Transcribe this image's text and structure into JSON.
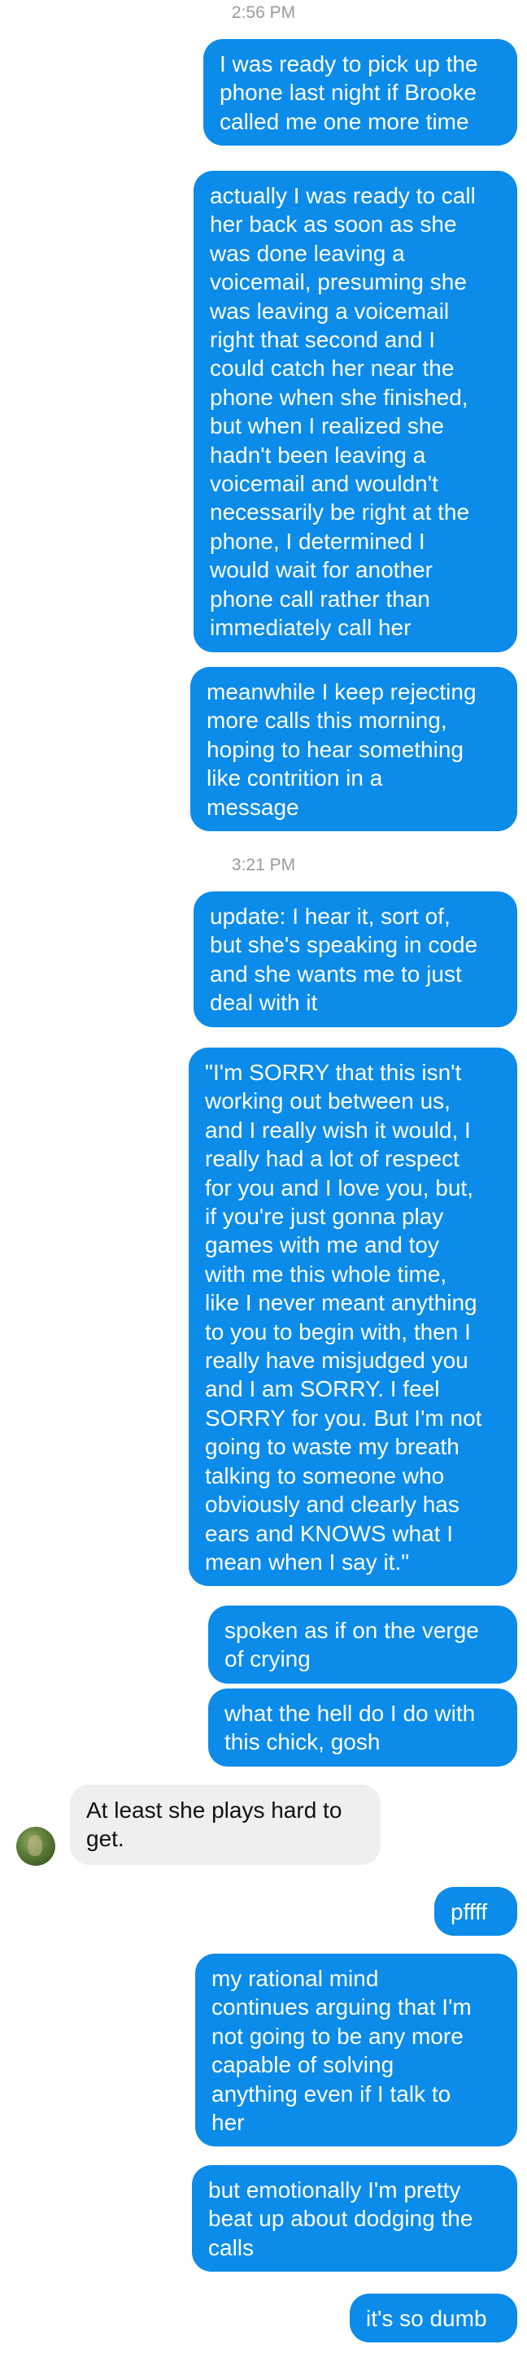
{
  "colors": {
    "outgoing_bubble": "#0b8bea",
    "incoming_bubble": "#efefef",
    "timestamp_text": "#9a9a9a"
  },
  "timestamps": [
    "2:56 PM",
    "3:21 PM"
  ],
  "messages": [
    {
      "side": "outgoing",
      "text": "I was ready to pick up the\nphone last night if Brooke\ncalled me one more time"
    },
    {
      "side": "outgoing",
      "text": "actually I was ready to call\nher back as soon as she\nwas done leaving a\nvoicemail, presuming she\nwas leaving a voicemail\nright that second and I\ncould catch her near the\nphone when she finished,\nbut when I realized she\nhadn't been leaving a\nvoicemail and wouldn't\nnecessarily be right at the\nphone, I determined I\nwould wait for another\nphone call rather than\nimmediately call her"
    },
    {
      "side": "outgoing",
      "text": "meanwhile I keep rejecting\nmore calls this morning,\nhoping to hear something\nlike contrition in a\nmessage"
    },
    {
      "side": "outgoing",
      "text": "update: I hear it, sort of,\nbut she's speaking in code\nand she wants me to just\ndeal with it"
    },
    {
      "side": "outgoing",
      "text": "\"I'm SORRY that this isn't\nworking out between us,\nand I really wish it would, I\nreally had a lot of respect\nfor you and I love you, but,\nif you're just gonna play\ngames with me and toy\nwith me this whole time,\nlike I never meant anything\nto you to begin with, then I\nreally have misjudged you\nand I am SORRY. I feel\nSORRY for you. But I'm not\ngoing to waste my breath\ntalking to someone who\nobviously and clearly has\nears and KNOWS what I\nmean when I say it.\""
    },
    {
      "side": "outgoing",
      "text": "spoken as if on the verge\nof crying"
    },
    {
      "side": "outgoing",
      "text": "what the hell do I do with\nthis chick, gosh"
    },
    {
      "side": "incoming",
      "text": "At least she plays hard to\nget."
    },
    {
      "side": "outgoing",
      "text": "pffff"
    },
    {
      "side": "outgoing",
      "text": "my rational mind\ncontinues arguing that I'm\nnot going to be any more\ncapable of solving\nanything even if I talk to\nher"
    },
    {
      "side": "outgoing",
      "text": "but emotionally I'm pretty\nbeat up about dodging the\ncalls"
    },
    {
      "side": "outgoing",
      "text": "it's so dumb"
    }
  ]
}
